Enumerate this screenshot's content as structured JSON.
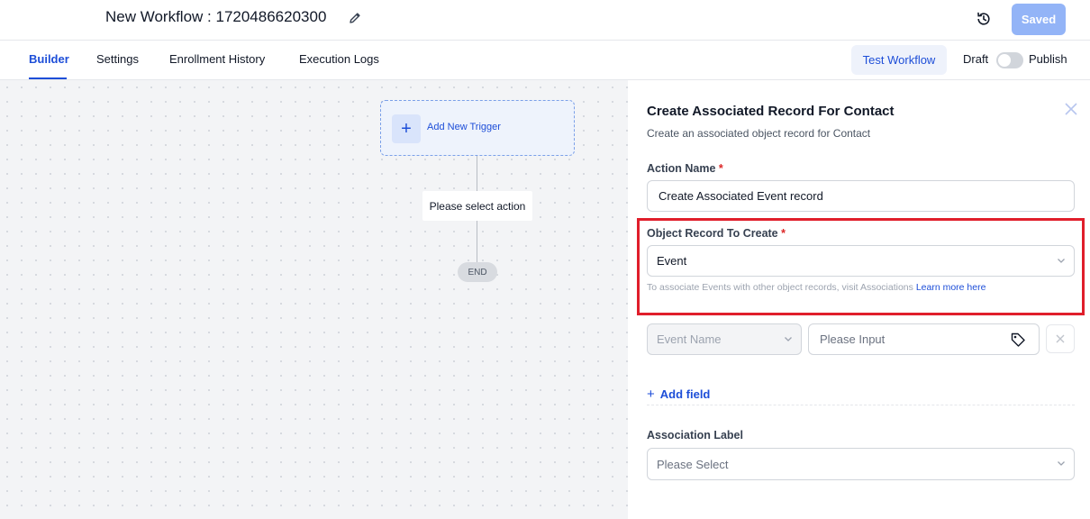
{
  "header": {
    "workflow_title": "New Workflow : 1720486620300",
    "saved_label": "Saved"
  },
  "tabs": [
    {
      "label": "Builder",
      "active": true
    },
    {
      "label": "Settings",
      "active": false
    },
    {
      "label": "Enrollment History",
      "active": false
    },
    {
      "label": "Execution Logs",
      "active": false
    }
  ],
  "toolbar": {
    "test_workflow_label": "Test Workflow",
    "draft_label": "Draft",
    "publish_label": "Publish",
    "publish_toggle_on": false
  },
  "canvas": {
    "trigger_label": "Add New Trigger",
    "trigger_plus": "+",
    "action_placeholder": "Please select action",
    "end_label": "END"
  },
  "panel": {
    "title": "Create Associated Record For Contact",
    "subtitle": "Create an associated object record for Contact",
    "action_name_label": "Action Name",
    "action_name_value": "Create Associated Event record",
    "required_mark": "*",
    "object_record_label": "Object Record To Create",
    "object_record_value": "Event",
    "hint_text": "To associate Events with other object records, visit Associations",
    "hint_link": "Learn more here",
    "field_select_placeholder": "Event Name",
    "field_input_placeholder": "Please Input",
    "add_field_label": "Add field",
    "add_field_plus": "+",
    "association_label": "Association Label",
    "association_placeholder": "Please Select"
  },
  "colors": {
    "accent": "#1d4ed8",
    "saved_button": "#93b4f7",
    "highlight_border": "#e01e2b",
    "required": "#dc2626"
  },
  "icons": [
    "edit-icon",
    "history-icon",
    "close-icon",
    "chevron-down-icon",
    "tag-icon",
    "plus-icon"
  ]
}
